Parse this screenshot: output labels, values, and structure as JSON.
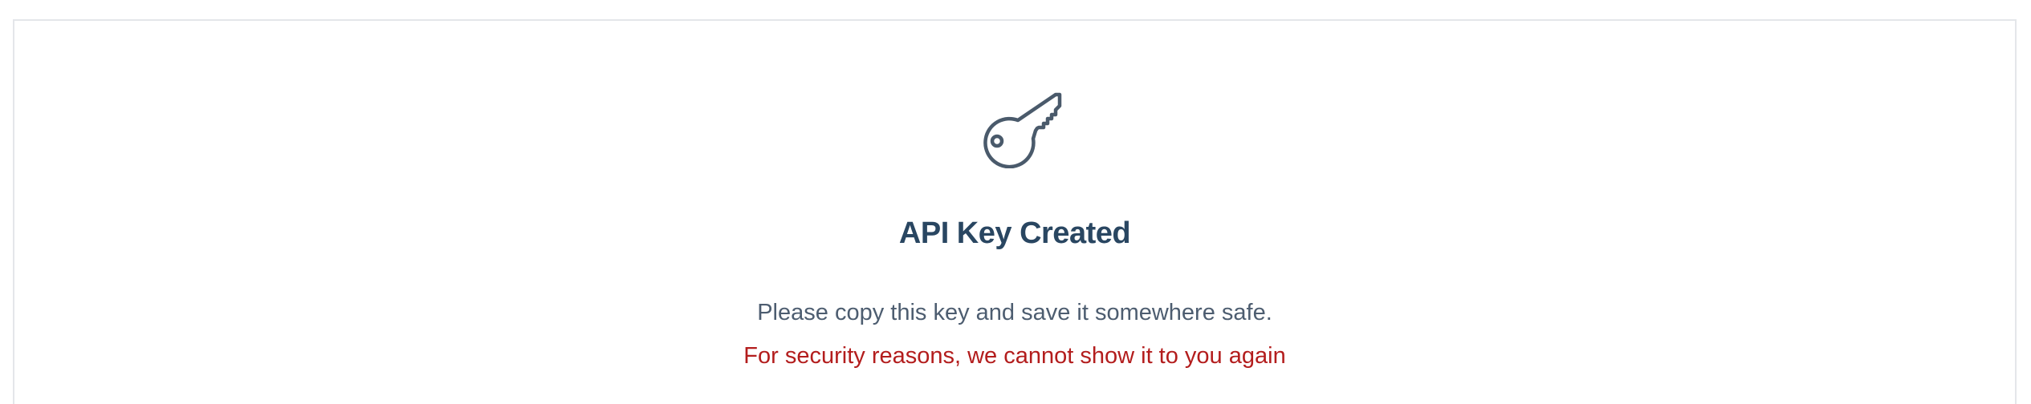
{
  "dialog": {
    "icon": "key-icon",
    "title": "API Key Created",
    "message": "Please copy this key and save it somewhere safe.",
    "warning": "For security reasons, we cannot show it to you again"
  },
  "colors": {
    "icon": "#4a5a6b",
    "title": "#294661",
    "message": "#4d5d70",
    "warning": "#b31d1d",
    "border": "#e4e6ea"
  }
}
